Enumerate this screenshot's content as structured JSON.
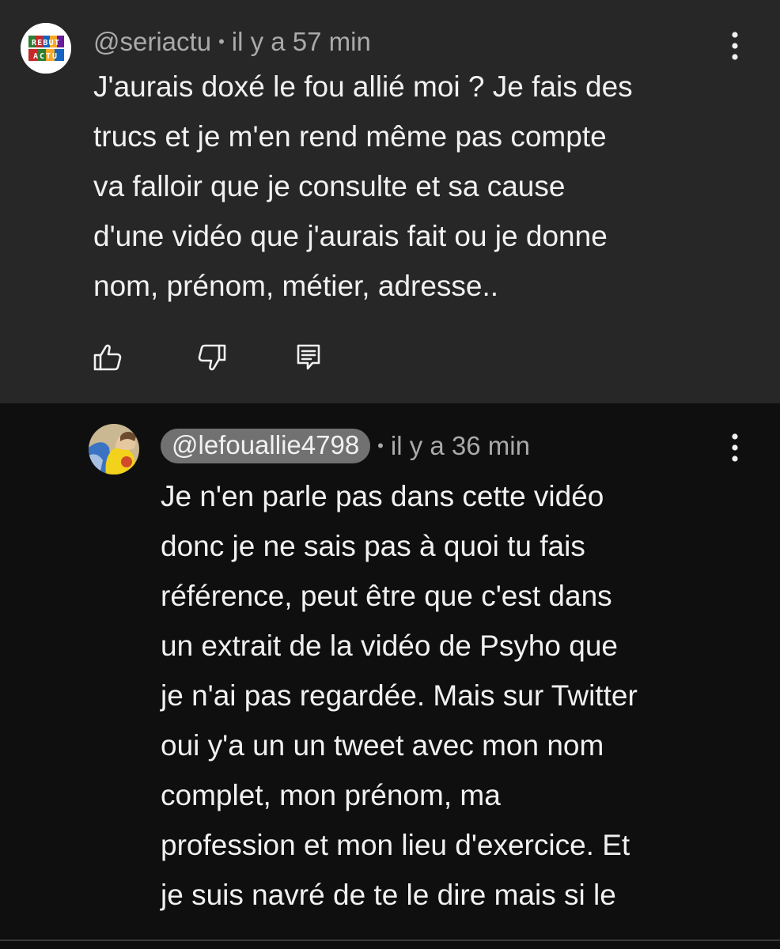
{
  "top_comment": {
    "avatar_text": [
      "REBUT",
      "ACTU"
    ],
    "handle": "@seriactu",
    "time": "il y a 57 min",
    "lines": [
      "J'aurais doxé le fou allié moi ? Je fais des",
      "trucs et je m'en rend même pas compte",
      "va falloir que je consulte et sa cause",
      "d'une vidéo que j'aurais fait ou je donne",
      "nom, prénom, métier, adresse.."
    ],
    "actions": {
      "like_icon": "thumbs-up-icon",
      "dislike_icon": "thumbs-down-icon",
      "reply_icon": "reply-icon"
    }
  },
  "reply_comment": {
    "handle": "@lefouallie4798",
    "time": "il y a 36 min",
    "lines": [
      "Je n'en parle pas dans cette vidéo",
      "donc je ne sais pas à quoi tu fais",
      "référence, peut être que c'est dans",
      "un extrait de la vidéo de Psyho que",
      "je n'ai pas regardée. Mais sur Twitter",
      "oui y'a un un tweet avec mon nom",
      "complet, mon prénom, ma",
      "profession et mon lieu d'exercice. Et",
      "je suis navré de te le dire mais si le"
    ]
  },
  "separator": "•",
  "colors": {
    "top_bg": "#272727",
    "reply_bg": "#0f0f0f",
    "text": "#f1f1f1",
    "meta": "#aaaaaa",
    "chip": "#717171"
  }
}
